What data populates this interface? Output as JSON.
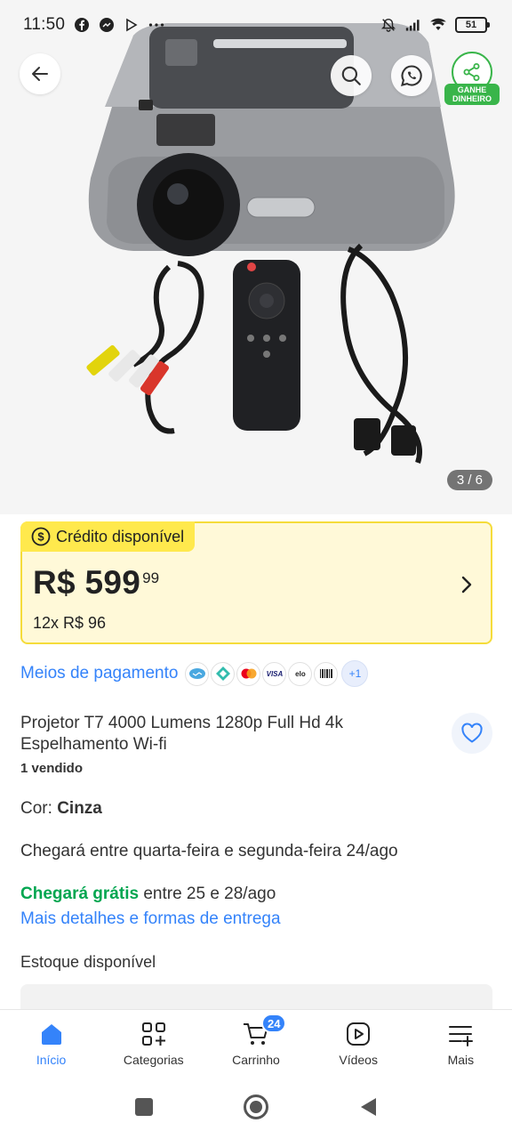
{
  "status_bar": {
    "time": "11:50",
    "icons": [
      "facebook-icon",
      "messenger-icon",
      "play-icon",
      "more-dots-icon"
    ],
    "battery": "51"
  },
  "gallery": {
    "counter": "3 / 6",
    "share_label": "GANHE DINHEIRO"
  },
  "credit": {
    "tag": "Crédito disponível",
    "price": "R$ 599",
    "cents": "99",
    "installments": "12x R$ 96"
  },
  "payment": {
    "link": "Meios de pagamento",
    "more": "+1",
    "methods": [
      "mercado-pago-icon",
      "pix-icon",
      "mastercard-icon",
      "visa-icon",
      "elo-icon",
      "boleto-icon"
    ]
  },
  "product": {
    "title": "Projetor T7 4000 Lumens 1280p Full Hd 4k Espelhamento Wi-fi",
    "sold": "1 vendido",
    "color_label": "Cor: ",
    "color_value": "Cinza",
    "arrival": "Chegará entre quarta-feira e segunda-feira 24/ago",
    "free_label": "Chegará grátis",
    "free_rest": " entre 25 e 28/ago",
    "more_details": "Mais detalhes e formas de entrega",
    "stock": "Estoque disponível"
  },
  "bottom_nav": {
    "items": [
      {
        "label": "Início",
        "icon": "home-icon"
      },
      {
        "label": "Categorias",
        "icon": "categories-icon"
      },
      {
        "label": "Carrinho",
        "icon": "cart-icon"
      },
      {
        "label": "Vídeos",
        "icon": "video-icon"
      },
      {
        "label": "Mais",
        "icon": "menu-plus-icon"
      }
    ],
    "cart_badge": "24"
  },
  "colors": {
    "accent": "#3483fa",
    "credit_bg": "#fff9d8",
    "credit_border": "#f5dc3a",
    "green": "#00a650"
  }
}
